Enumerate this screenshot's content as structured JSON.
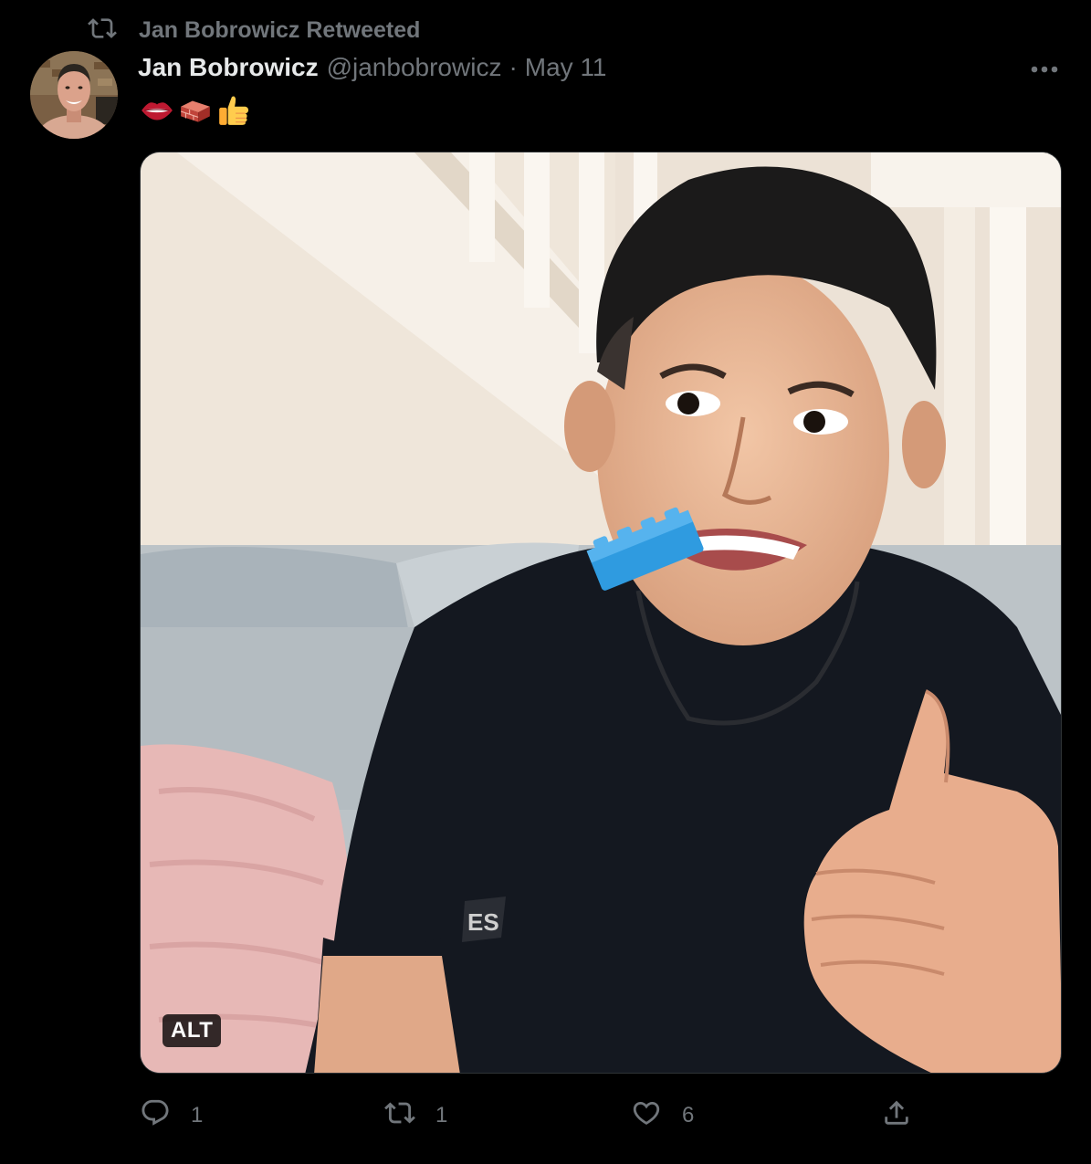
{
  "retweet": {
    "icon": "retweet-icon",
    "label": "Jan Bobrowicz Retweeted"
  },
  "author": {
    "avatar": "avatar",
    "name": "Jan Bobrowicz",
    "handle": "@janbobrowicz",
    "separator": "·",
    "date": "May 11"
  },
  "more_icon": "more-icon",
  "emojis": [
    "lips-icon",
    "brick-icon",
    "thumbs-up-icon"
  ],
  "media": {
    "alt_badge": "ALT"
  },
  "actions": {
    "reply": {
      "icon": "reply-icon",
      "count": "1"
    },
    "retweet": {
      "icon": "retweet-icon",
      "count": "1"
    },
    "like": {
      "icon": "heart-icon",
      "count": "6"
    },
    "share": {
      "icon": "share-icon"
    }
  },
  "colors": {
    "background": "#000000",
    "primary_text": "#e7e9ea",
    "secondary_text": "#71767b",
    "border": "#2f3336"
  }
}
